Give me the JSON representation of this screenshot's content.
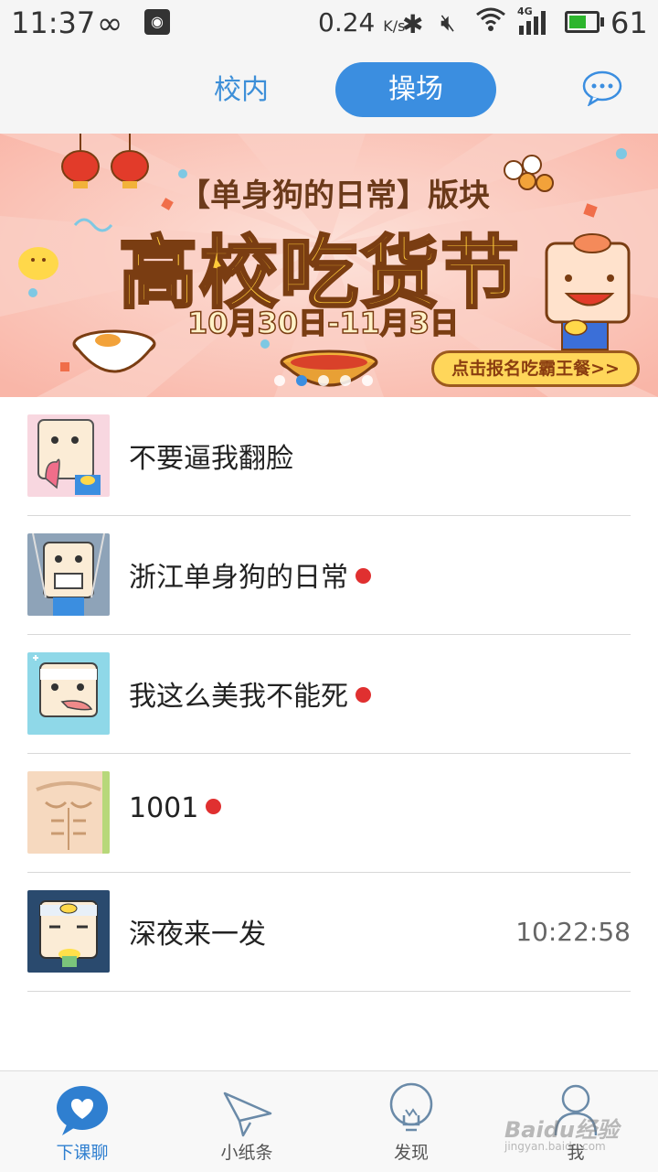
{
  "status_bar": {
    "time": "11:37",
    "speed": "0.24",
    "speed_unit": "K/s",
    "network": "4G",
    "battery_percent": "61",
    "battery_level": 0.61,
    "icons": [
      "infinity-icon",
      "weibo-icon",
      "bluetooth-icon",
      "mute-icon",
      "wifi-icon",
      "signal-icon",
      "battery-icon"
    ]
  },
  "header": {
    "tabs": [
      {
        "label": "校内",
        "active": false
      },
      {
        "label": "操场",
        "active": true
      }
    ],
    "chat_icon": "chat-bubble-icon",
    "accent": "#3b8ee0"
  },
  "banner": {
    "tag": "【单身狗的日常】版块",
    "title": "高校吃货节",
    "date": "10月30日-11月3日",
    "cta": "点击报名吃霸王餐>>",
    "slide_count": 5,
    "active_slide": 2,
    "colors": {
      "background": "#fbc3b8",
      "title": "#ffcb3a"
    }
  },
  "conversations": [
    {
      "name": "不要逼我翻脸",
      "unread": false,
      "time": ""
    },
    {
      "name": "浙江单身狗的日常",
      "unread": true,
      "time": ""
    },
    {
      "name": "我这么美我不能死",
      "unread": true,
      "time": ""
    },
    {
      "name": "1001",
      "unread": true,
      "time": ""
    },
    {
      "name": "深夜来一发",
      "unread": false,
      "time": "10:22:58"
    }
  ],
  "bottom_nav": [
    {
      "label": "下课聊",
      "icon": "heart-chat-icon",
      "active": true
    },
    {
      "label": "小纸条",
      "icon": "paper-plane-icon",
      "active": false
    },
    {
      "label": "发现",
      "icon": "lightbulb-icon",
      "active": false
    },
    {
      "label": "我",
      "icon": "person-icon",
      "active": false
    }
  ],
  "watermark": {
    "text": "Baidu经验",
    "sub": "jingyan.baidu.com"
  }
}
